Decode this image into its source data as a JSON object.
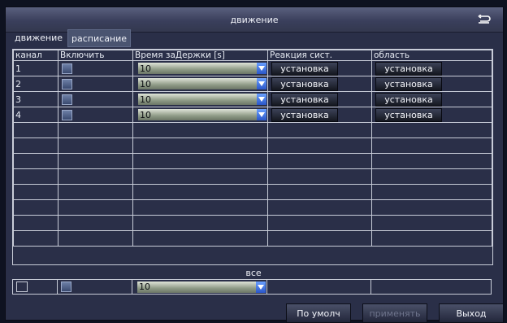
{
  "window": {
    "title": "движение"
  },
  "tabs": [
    {
      "label": "движение",
      "active": true
    },
    {
      "label": "расписание",
      "active": false
    }
  ],
  "table": {
    "headers": [
      "канал",
      "Включить",
      "Время заДержки [s]",
      "Реакция сист.",
      "область"
    ],
    "rows": [
      {
        "channel": "1",
        "enabled": true,
        "delay": "10",
        "reaction_button": "установка",
        "area_button": "установка"
      },
      {
        "channel": "2",
        "enabled": true,
        "delay": "10",
        "reaction_button": "установка",
        "area_button": "установка"
      },
      {
        "channel": "3",
        "enabled": true,
        "delay": "10",
        "reaction_button": "установка",
        "area_button": "установка"
      },
      {
        "channel": "4",
        "enabled": true,
        "delay": "10",
        "reaction_button": "установка",
        "area_button": "установка"
      }
    ],
    "empty_rows": 8
  },
  "all_section": {
    "label": "все",
    "select_all_checked": false,
    "enabled": true,
    "delay": "10"
  },
  "footer": {
    "default_label": "По умолч",
    "apply_label": "применять",
    "exit_label": "Выход"
  },
  "colors": {
    "panel": "#2a2f48",
    "grid_line": "#c8ccd8",
    "select_arrow": "#2a56c8"
  }
}
